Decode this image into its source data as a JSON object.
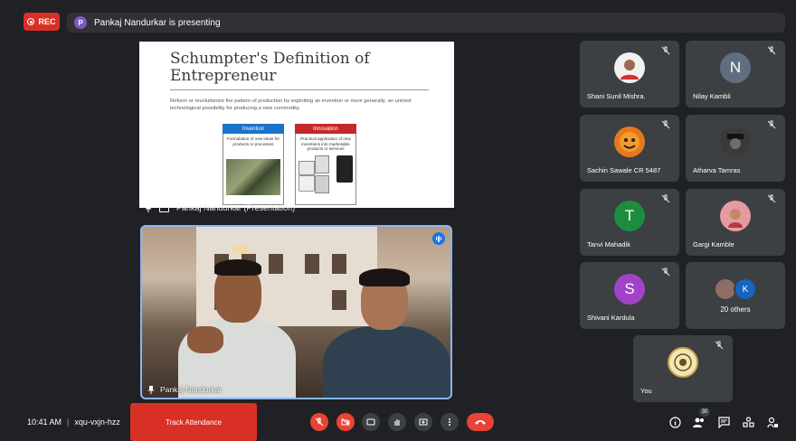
{
  "recording": {
    "label": "REC"
  },
  "presenting_bar": {
    "avatar_letter": "P",
    "text": "Pankaj Nandurkar is presenting"
  },
  "slide": {
    "title": "Schumpter's Definition of Entrepreneur",
    "body": "Reform or revolutionize the pattern of production by exploiting an invention or more generally, an untried technological possibility for producing a new commodity.",
    "invention": {
      "header": "Invention",
      "text": "Formulation of new ideas for products or processes"
    },
    "innovation": {
      "header": "Innovation",
      "text": "Practical application of new inventions into marketable products or services"
    }
  },
  "presentation_caption": "Pankaj Nandurkar (Presentation)",
  "main_video": {
    "name": "Pankaj Nandurkar"
  },
  "participants": [
    {
      "name": "Shani Sunil Mishra.",
      "avatar": "photo",
      "color": "#f1f1f1"
    },
    {
      "name": "Nilay Kambli",
      "avatar": "N",
      "color": "#5f6f80"
    },
    {
      "name": "Sachin Sawale CR 5487",
      "avatar": "photo",
      "color": "#e6781e"
    },
    {
      "name": "Atharva Tamras",
      "avatar": "photo",
      "color": "#3a3a3a"
    },
    {
      "name": "Tanvi Mahadik",
      "avatar": "T",
      "color": "#1e8e3e"
    },
    {
      "name": "Gargi Kamble",
      "avatar": "photo",
      "color": "#e89aa2"
    },
    {
      "name": "Shivani Kardula",
      "avatar": "S",
      "color": "#a142c8"
    }
  ],
  "others_tile": {
    "label": "20 others",
    "avatar_letter": "K"
  },
  "self_tile": {
    "name": "You"
  },
  "bottom_bar": {
    "time": "10:41 AM",
    "meeting_code": "xqu-vxjn-hzz",
    "track_attendance": "Track Attendance",
    "people_count": "30"
  }
}
